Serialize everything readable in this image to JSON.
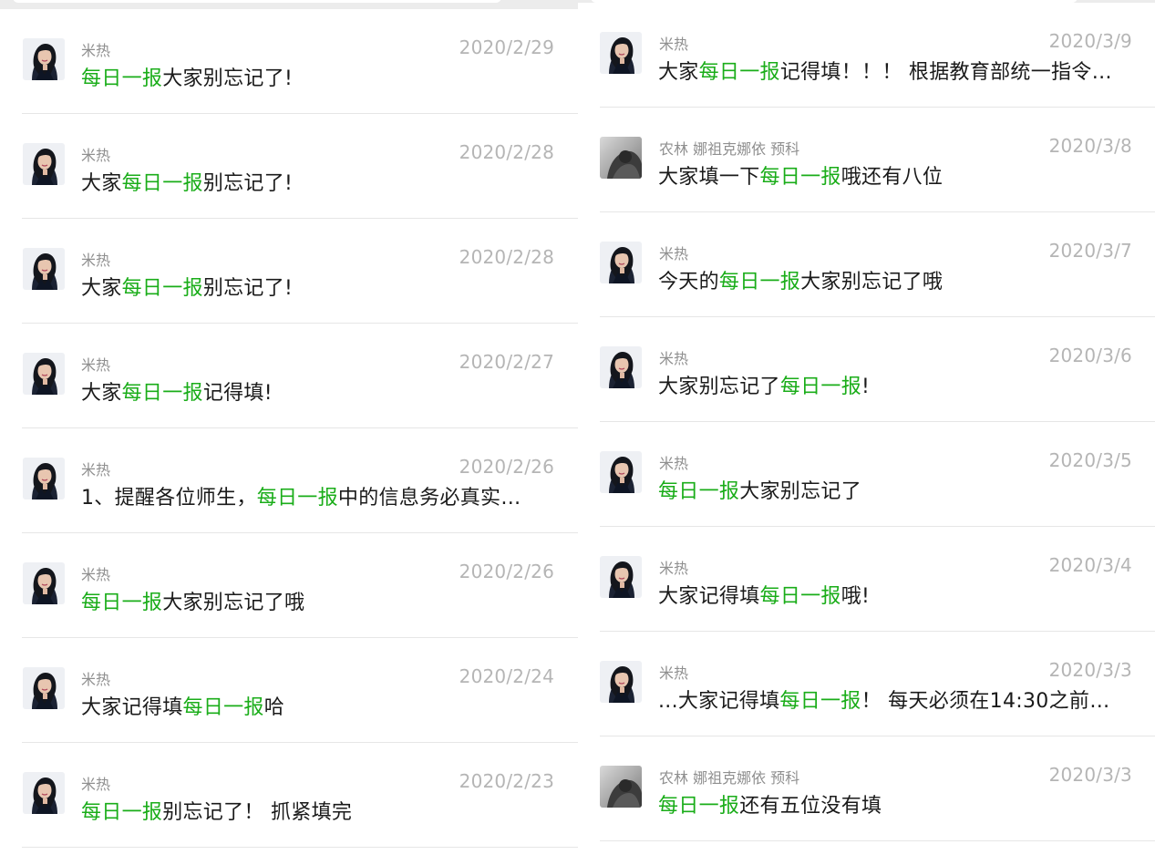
{
  "colors": {
    "keyword_highlight": "#1aad19",
    "message_text": "#1a1a1a",
    "sender_text": "#8f8f8f",
    "date_text": "#b5b5b5",
    "divider": "#e6e6e6",
    "top_bar": "#ececec"
  },
  "avatars": {
    "mire": "portrait-avatar-dark-hair",
    "nonglin": "grayscale-avatar"
  },
  "left_panel": {
    "messages": [
      {
        "avatar": "mire",
        "sender": "米热",
        "date": "2020/2/29",
        "before": "",
        "keyword": "每日一报",
        "after": "大家别忘记了!"
      },
      {
        "avatar": "mire",
        "sender": "米热",
        "date": "2020/2/28",
        "before": "大家",
        "keyword": "每日一报",
        "after": "别忘记了!"
      },
      {
        "avatar": "mire",
        "sender": "米热",
        "date": "2020/2/28",
        "before": "大家",
        "keyword": "每日一报",
        "after": "别忘记了!"
      },
      {
        "avatar": "mire",
        "sender": "米热",
        "date": "2020/2/27",
        "before": "大家",
        "keyword": "每日一报",
        "after": "记得填!"
      },
      {
        "avatar": "mire",
        "sender": "米热",
        "date": "2020/2/26",
        "before": "1、提醒各位师生，",
        "keyword": "每日一报",
        "after": "中的信息务必真实…"
      },
      {
        "avatar": "mire",
        "sender": "米热",
        "date": "2020/2/26",
        "before": "",
        "keyword": "每日一报",
        "after": "大家别忘记了哦"
      },
      {
        "avatar": "mire",
        "sender": "米热",
        "date": "2020/2/24",
        "before": "大家记得填",
        "keyword": "每日一报",
        "after": "哈"
      },
      {
        "avatar": "mire",
        "sender": "米热",
        "date": "2020/2/23",
        "before": "",
        "keyword": "每日一报",
        "after": "别忘记了！ 抓紧填完"
      }
    ]
  },
  "right_panel": {
    "messages": [
      {
        "avatar": "mire",
        "sender": "米热",
        "date": "2020/3/9",
        "before": "大家",
        "keyword": "每日一报",
        "after": "记得填！！！ 根据教育部统一指令…"
      },
      {
        "avatar": "nonglin",
        "sender": "农林 娜祖克娜依 预科",
        "date": "2020/3/8",
        "before": "大家填一下",
        "keyword": "每日一报",
        "after": "哦还有八位"
      },
      {
        "avatar": "mire",
        "sender": "米热",
        "date": "2020/3/7",
        "before": "今天的",
        "keyword": "每日一报",
        "after": "大家别忘记了哦"
      },
      {
        "avatar": "mire",
        "sender": "米热",
        "date": "2020/3/6",
        "before": "大家别忘记了",
        "keyword": "每日一报",
        "after": "!"
      },
      {
        "avatar": "mire",
        "sender": "米热",
        "date": "2020/3/5",
        "before": "",
        "keyword": "每日一报",
        "after": "大家别忘记了"
      },
      {
        "avatar": "mire",
        "sender": "米热",
        "date": "2020/3/4",
        "before": "大家记得填",
        "keyword": "每日一报",
        "after": "哦!"
      },
      {
        "avatar": "mire",
        "sender": "米热",
        "date": "2020/3/3",
        "before": "...大家记得填",
        "keyword": "每日一报",
        "after": "！ 每天必须在14:30之前…"
      },
      {
        "avatar": "nonglin",
        "sender": "农林 娜祖克娜依 预科",
        "date": "2020/3/3",
        "before": "",
        "keyword": "每日一报",
        "after": "还有五位没有填"
      }
    ]
  }
}
